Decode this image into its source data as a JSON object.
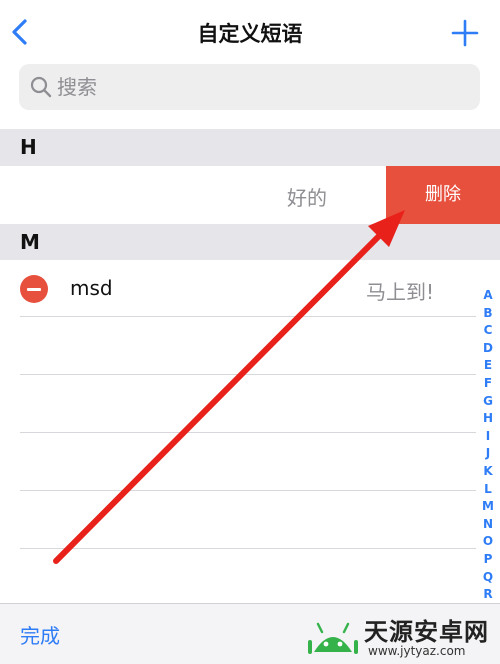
{
  "nav": {
    "title": "自定义短语"
  },
  "search": {
    "placeholder": "搜索"
  },
  "sections": [
    {
      "letter": "H",
      "items": [
        {
          "phrase": "好的",
          "action": "删除"
        }
      ]
    },
    {
      "letter": "M",
      "items": [
        {
          "shortcut": "msd",
          "phrase": "马上到!"
        }
      ]
    }
  ],
  "index_letters": [
    "A",
    "B",
    "C",
    "D",
    "E",
    "F",
    "G",
    "H",
    "I",
    "J",
    "K",
    "L",
    "M",
    "N",
    "O",
    "P",
    "Q",
    "R"
  ],
  "toolbar": {
    "done_label": "完成"
  },
  "watermark": {
    "name": "天源安卓网",
    "url": "www.jytyaz.com"
  },
  "colors": {
    "accent": "#2f7df6",
    "delete": "#e8503e",
    "annotation_arrow": "#e8211a"
  }
}
